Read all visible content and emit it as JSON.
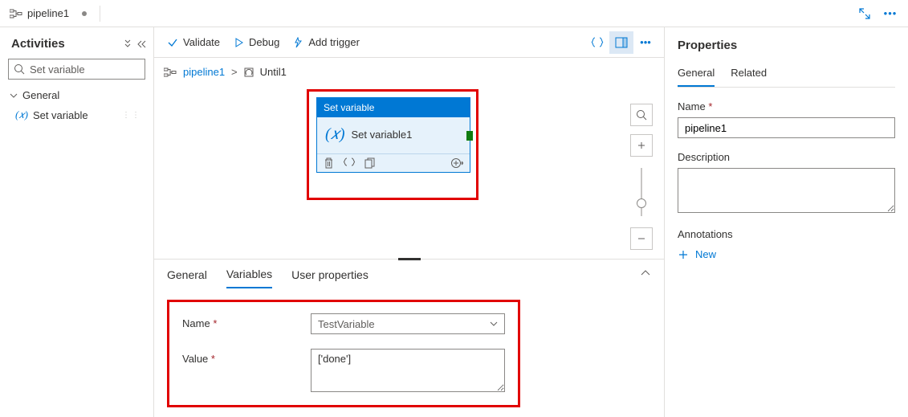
{
  "tab": {
    "title": "pipeline1"
  },
  "sidebar": {
    "title": "Activities",
    "search_value": "Set variable",
    "category": "General",
    "items": [
      {
        "label": "Set variable"
      }
    ]
  },
  "toolbar": {
    "validate": "Validate",
    "debug": "Debug",
    "add_trigger": "Add trigger"
  },
  "breadcrumb": {
    "root": "pipeline1",
    "child": "Until1"
  },
  "activity": {
    "type_label": "Set variable",
    "name": "Set variable1"
  },
  "bottom": {
    "tabs": {
      "general": "General",
      "variables": "Variables",
      "user_props": "User properties"
    },
    "name_label": "Name",
    "name_value": "TestVariable",
    "value_label": "Value",
    "value_value": "['done']"
  },
  "props": {
    "title": "Properties",
    "tabs": {
      "general": "General",
      "related": "Related"
    },
    "name_label": "Name",
    "name_value": "pipeline1",
    "desc_label": "Description",
    "desc_value": "",
    "annotations_label": "Annotations",
    "new_label": "New"
  }
}
